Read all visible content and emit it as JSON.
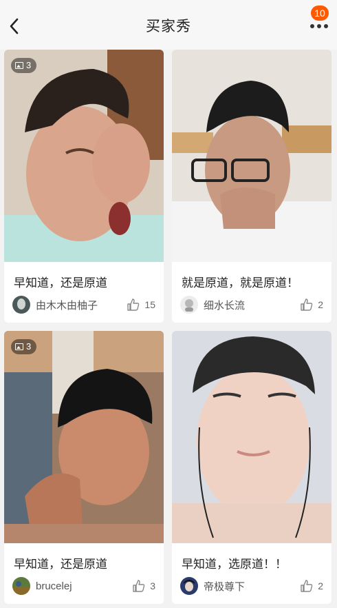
{
  "header": {
    "title": "买家秀",
    "notification_count": "10",
    "back_icon": "chevron-left-icon",
    "more_icon": "more-dots-icon"
  },
  "colors": {
    "badge": "#ff5a00",
    "page_background": "#f2f2f2",
    "card_background": "#ffffff"
  },
  "posts": [
    {
      "caption": "早知道，还是原道",
      "author": "由木木由柚子",
      "likes": "15",
      "image_count": "3"
    },
    {
      "caption": "就是原道，就是原道！",
      "author": "细水长流",
      "likes": "2",
      "image_count": ""
    },
    {
      "caption": "早知道，还是原道",
      "author": "brucelej",
      "likes": "3",
      "image_count": "3"
    },
    {
      "caption": "早知道，选原道！！",
      "author": "帝极尊下",
      "likes": "2",
      "image_count": ""
    }
  ]
}
